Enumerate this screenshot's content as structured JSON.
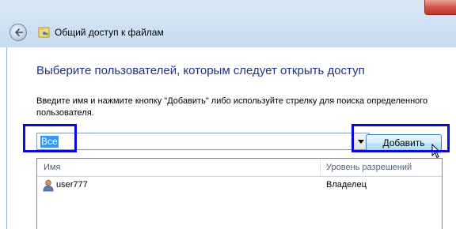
{
  "window": {
    "title": "Общий доступ к файлам"
  },
  "page": {
    "heading": "Выберите пользователей, которым следует открыть доступ",
    "instruction_line1": "Введите имя и нажмите кнопку \"Добавить\" либо используйте стрелку для поиска определенного",
    "instruction_line2": "пользователя."
  },
  "input": {
    "value": "Все"
  },
  "buttons": {
    "add_label": "Добавить"
  },
  "table": {
    "columns": [
      "Имя",
      "Уровень разрешений"
    ],
    "rows": [
      {
        "name": "user777",
        "permission": "Владелец"
      }
    ]
  },
  "icons": {
    "back": "back-arrow-icon",
    "app": "file-sharing-icon",
    "user": "user-icon",
    "dropdown": "chevron-down-icon"
  },
  "colors": {
    "heading": "#1e3287",
    "highlight": "#0a0ad2",
    "selection": "#3399ff"
  }
}
